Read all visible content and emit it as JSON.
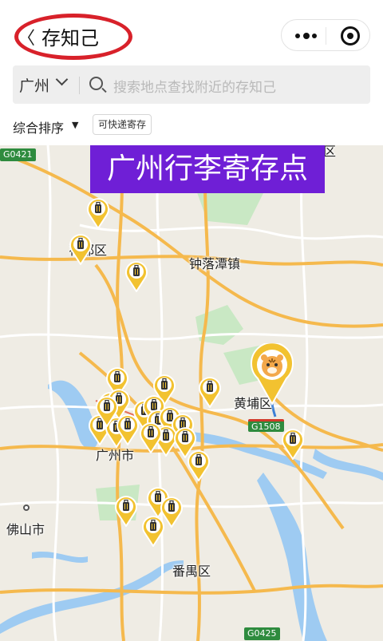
{
  "header": {
    "back_symbol": "〈",
    "title": "存知己",
    "more_icon": "more-dots-icon",
    "target_icon": "record-target-icon"
  },
  "search": {
    "city": "广州",
    "placeholder": "搜索地点查找附近的存知己"
  },
  "filters": {
    "sort_label": "综合排序",
    "sort_arrow": "▼",
    "quick_tag": "可快递寄存"
  },
  "banner": {
    "text": "广州行李寄存点"
  },
  "map": {
    "place_labels": {
      "huadu": "花都区",
      "zhongluotan": "钟落潭镇",
      "huangpu": "黄埔区",
      "guangzhou": "广州市",
      "foshan": "佛山市",
      "panyu": "番禺区",
      "top_right_partial": "区"
    },
    "road_shields": {
      "g0421": "G0421",
      "g1508": "G1508",
      "g0425": "G0425"
    },
    "colors": {
      "marker_fill": "#f2c230",
      "marker_border": "#ffffff",
      "banner_bg": "#6f1fd6",
      "water": "#9ecbf2",
      "park": "#c6e8c2",
      "highway": "#f5b94d",
      "road": "#ffffff"
    },
    "marker_icon": "luggage-icon",
    "current_location_icon": "tiger-avatar-pin-icon",
    "marker_count": 26
  }
}
